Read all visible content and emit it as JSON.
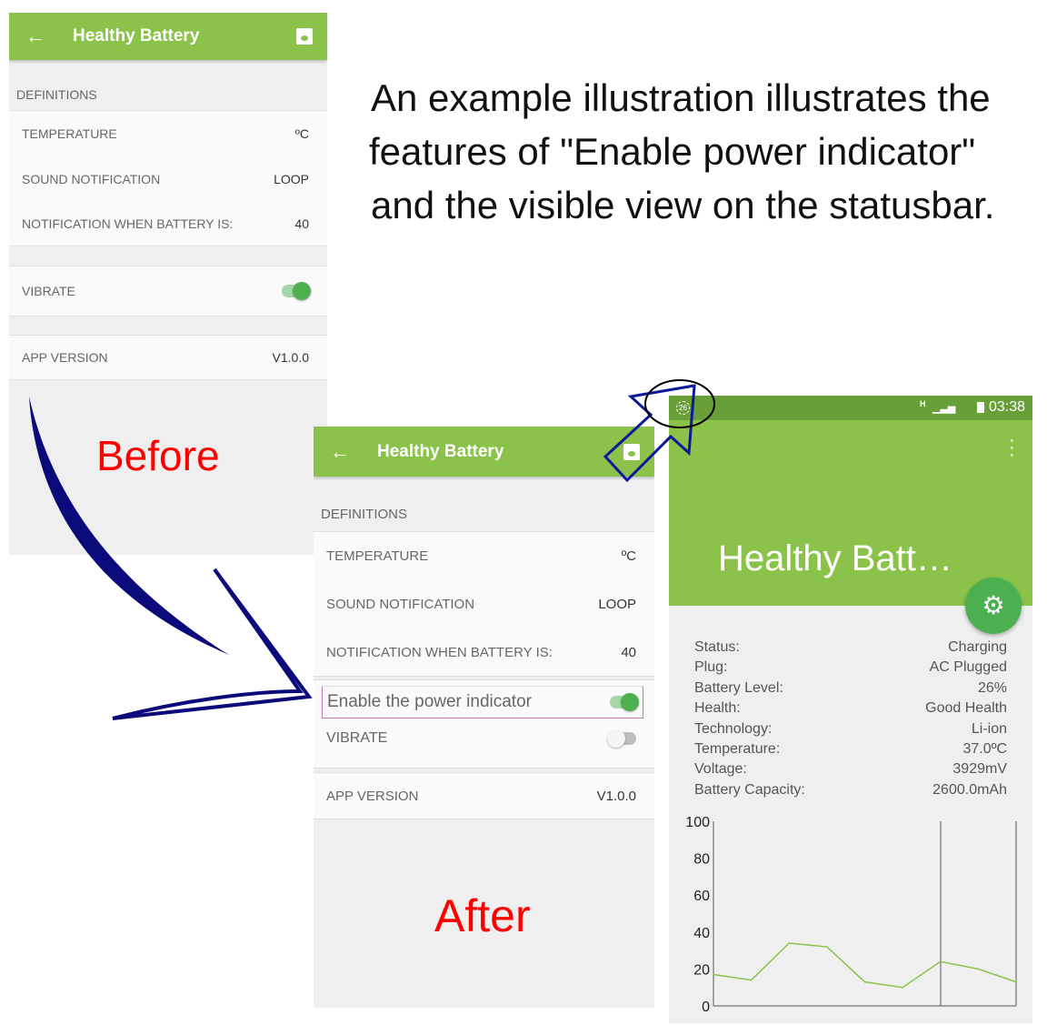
{
  "caption": [
    "An example illustration illustrates the",
    "features of \"Enable power indicator\"",
    "and the visible view on the statusbar."
  ],
  "before": {
    "title": "Healthy Battery",
    "label": "Before",
    "section": "DEFINITIONS",
    "rows": [
      {
        "k": "TEMPERATURE",
        "v": "ºC"
      },
      {
        "k": "SOUND NOTIFICATION",
        "v": "LOOP"
      },
      {
        "k": "NOTIFICATION WHEN BATTERY IS:",
        "v": "40"
      }
    ],
    "vibrate": "VIBRATE",
    "vibrate_on": true,
    "version_label": "APP VERSION",
    "version": "V1.0.0"
  },
  "after": {
    "title": "Healthy Battery",
    "label": "After",
    "section": "DEFINITIONS",
    "rows": [
      {
        "k": "TEMPERATURE",
        "v": "ºC"
      },
      {
        "k": "SOUND NOTIFICATION",
        "v": "LOOP"
      },
      {
        "k": "NOTIFICATION WHEN BATTERY IS:",
        "v": "40"
      }
    ],
    "power_indicator": "Enable the power indicator",
    "power_indicator_on": true,
    "vibrate": "VIBRATE",
    "vibrate_on": false,
    "version_label": "APP VERSION",
    "version": "V1.0.0"
  },
  "phone": {
    "status_badge": "26",
    "network": "H",
    "time": "03:38",
    "title": "Healthy Batt…",
    "info": [
      {
        "k": "Status:",
        "v": "Charging"
      },
      {
        "k": "Plug:",
        "v": "AC Plugged"
      },
      {
        "k": "Battery Level:",
        "v": "26%"
      },
      {
        "k": "Health:",
        "v": "Good Health"
      },
      {
        "k": "Technology:",
        "v": "Li-ion"
      },
      {
        "k": "Temperature:",
        "v": "37.0ºC"
      },
      {
        "k": "Voltage:",
        "v": "3929mV"
      },
      {
        "k": "Battery Capacity:",
        "v": "2600.0mAh"
      }
    ]
  },
  "colors": {
    "accent": "#8bc34a",
    "fab": "#4caf50",
    "label": "#ff0000",
    "arrow": "#0a0a7a"
  },
  "chart_data": {
    "type": "line",
    "ylim": [
      0,
      100
    ],
    "yticks": [
      0,
      20,
      40,
      60,
      80,
      100
    ],
    "values": [
      17,
      14,
      34,
      32,
      13,
      10,
      24,
      20,
      13
    ],
    "color": "#8bc34a"
  }
}
